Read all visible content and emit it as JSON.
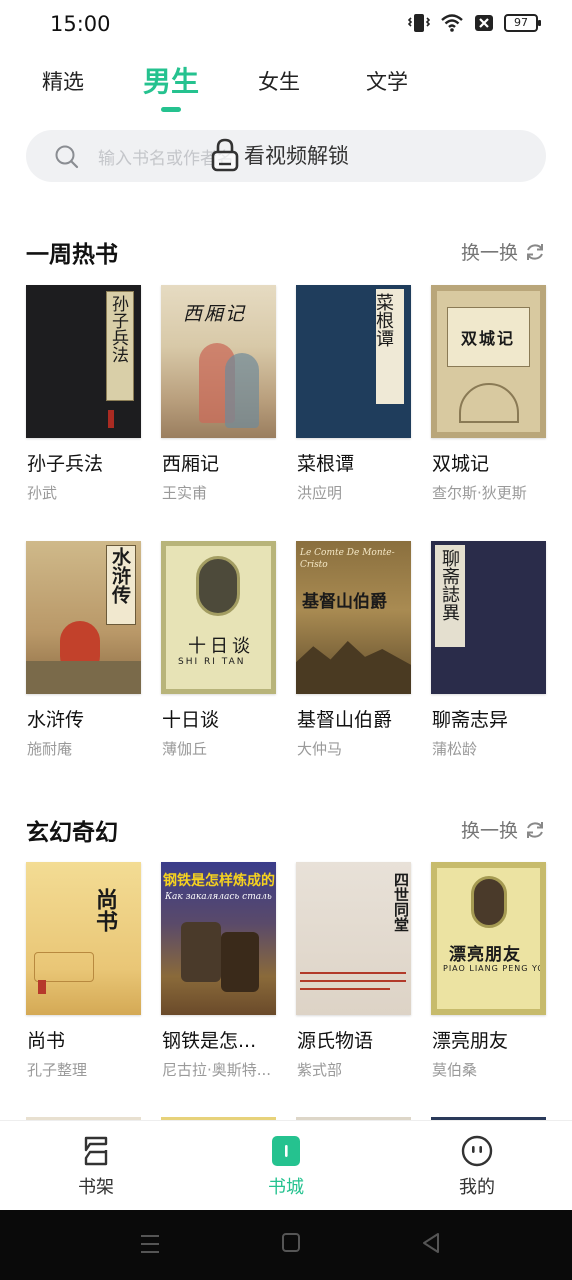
{
  "status_bar": {
    "time": "15:00",
    "battery": "97"
  },
  "top_tabs": [
    {
      "label": "精选",
      "active": false
    },
    {
      "label": "男生",
      "active": true
    },
    {
      "label": "女生",
      "active": false
    },
    {
      "label": "文学",
      "active": false
    }
  ],
  "search": {
    "placeholder": "输入书名或作者名",
    "unlock_overlay": "看视频解锁"
  },
  "sections": [
    {
      "title": "一周热书",
      "refresh_label": "换一换",
      "books": [
        {
          "title": "孙子兵法",
          "author": "孙武",
          "cover_text": "孙子兵法"
        },
        {
          "title": "西厢记",
          "author": "王实甫",
          "cover_text": "西厢记"
        },
        {
          "title": "菜根谭",
          "author": "洪应明",
          "cover_text": "菜根谭"
        },
        {
          "title": "双城记",
          "author": "查尔斯·狄更斯",
          "cover_text": "双城记"
        },
        {
          "title": "水浒传",
          "author": "施耐庵",
          "cover_text": "水浒传"
        },
        {
          "title": "十日谈",
          "author": "薄伽丘",
          "cover_text": "十日谈",
          "cover_subtext": "SHI RI TAN"
        },
        {
          "title": "基督山伯爵",
          "author": "大仲马",
          "cover_text": "基督山伯爵",
          "cover_subtext": "Le Comte De Monte-Cristo"
        },
        {
          "title": "聊斋志异",
          "author": "蒲松龄",
          "cover_text": "聊斋誌異"
        }
      ]
    },
    {
      "title": "玄幻奇幻",
      "refresh_label": "换一换",
      "books": [
        {
          "title": "尚书",
          "author": "孔子整理",
          "cover_text": "尚书"
        },
        {
          "title": "钢铁是怎...",
          "author": "尼古拉·奥斯特...",
          "cover_text": "钢铁是怎样炼成的",
          "cover_subtext": "Как закалялась сталь"
        },
        {
          "title": "源氏物语",
          "author": "紫式部",
          "cover_text": "四世同堂"
        },
        {
          "title": "漂亮朋友",
          "author": "莫伯桑",
          "cover_text": "漂亮朋友",
          "cover_subtext": "PIAO LIANG PENG YOU"
        }
      ]
    }
  ],
  "bottom_nav": [
    {
      "label": "书架",
      "icon": "bookshelf-icon",
      "active": false
    },
    {
      "label": "书城",
      "icon": "bookstore-icon",
      "active": true
    },
    {
      "label": "我的",
      "icon": "profile-face-icon",
      "active": false
    }
  ],
  "system_nav": {
    "icons": [
      "menu-icon",
      "home-icon",
      "back-icon"
    ]
  },
  "colors": {
    "accent": "#25c28f",
    "text": "#111111",
    "muted": "#9a9a9a"
  }
}
